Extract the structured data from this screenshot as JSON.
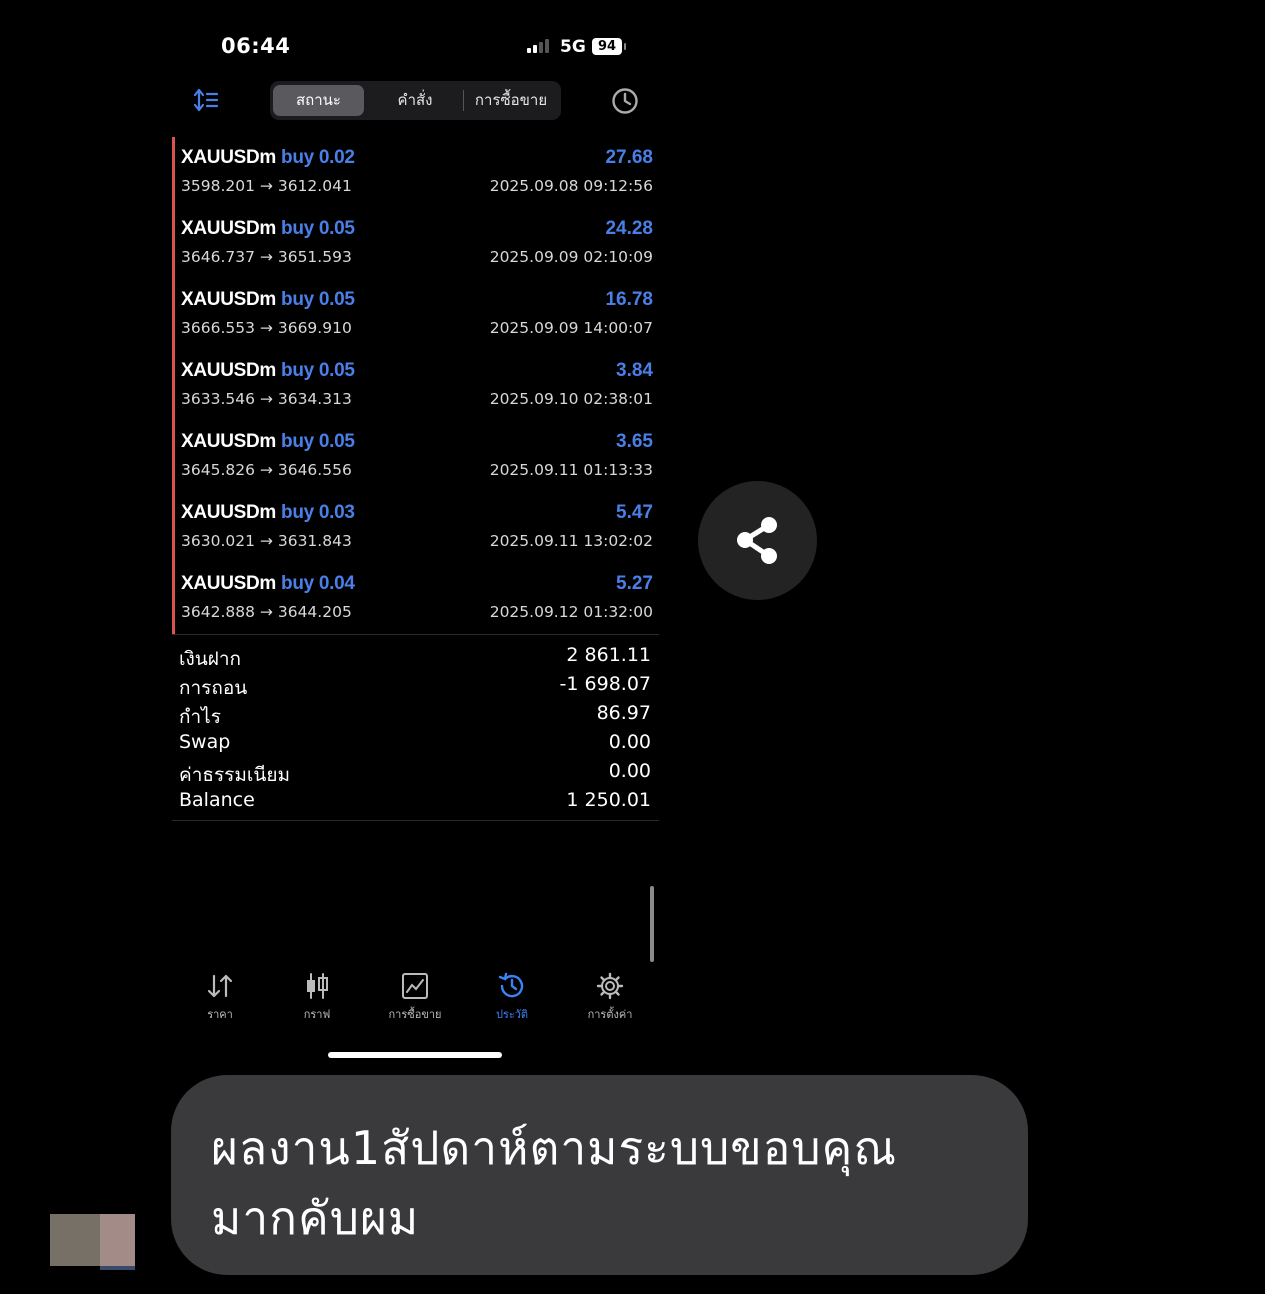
{
  "status_bar": {
    "time": "06:44",
    "network": "5G",
    "battery": "94"
  },
  "top_tabs": [
    "สถานะ",
    "คำสั่ง",
    "การซื้อขาย"
  ],
  "trades": [
    {
      "symbol": "XAUUSDm",
      "side": "buy",
      "volume": "0.02",
      "open": "3598.201",
      "close": "3612.041",
      "arrow": "→",
      "profit": "27.68",
      "time": "2025.09.08 09:12:56"
    },
    {
      "symbol": "XAUUSDm",
      "side": "buy",
      "volume": "0.05",
      "open": "3646.737",
      "close": "3651.593",
      "arrow": "→",
      "profit": "24.28",
      "time": "2025.09.09 02:10:09"
    },
    {
      "symbol": "XAUUSDm",
      "side": "buy",
      "volume": "0.05",
      "open": "3666.553",
      "close": "3669.910",
      "arrow": "→",
      "profit": "16.78",
      "time": "2025.09.09 14:00:07"
    },
    {
      "symbol": "XAUUSDm",
      "side": "buy",
      "volume": "0.05",
      "open": "3633.546",
      "close": "3634.313",
      "arrow": "→",
      "profit": "3.84",
      "time": "2025.09.10 02:38:01"
    },
    {
      "symbol": "XAUUSDm",
      "side": "buy",
      "volume": "0.05",
      "open": "3645.826",
      "close": "3646.556",
      "arrow": "→",
      "profit": "3.65",
      "time": "2025.09.11 01:13:33"
    },
    {
      "symbol": "XAUUSDm",
      "side": "buy",
      "volume": "0.03",
      "open": "3630.021",
      "close": "3631.843",
      "arrow": "→",
      "profit": "5.47",
      "time": "2025.09.11 13:02:02"
    },
    {
      "symbol": "XAUUSDm",
      "side": "buy",
      "volume": "0.04",
      "open": "3642.888",
      "close": "3644.205",
      "arrow": "→",
      "profit": "5.27",
      "time": "2025.09.12 01:32:00"
    }
  ],
  "summary": [
    {
      "label": "เงินฝาก",
      "value": "2 861.11"
    },
    {
      "label": "การถอน",
      "value": "-1 698.07"
    },
    {
      "label": "กำไร",
      "value": "86.97"
    },
    {
      "label": "Swap",
      "value": "0.00"
    },
    {
      "label": "ค่าธรรมเนียม",
      "value": "0.00"
    },
    {
      "label": "Balance",
      "value": "1 250.01"
    }
  ],
  "bottom_nav": [
    {
      "label": "ราคา",
      "icon": "arrows-updown-icon"
    },
    {
      "label": "กราฟ",
      "icon": "candlestick-icon"
    },
    {
      "label": "การซื้อขาย",
      "icon": "trade-chart-icon"
    },
    {
      "label": "ประวัติ",
      "icon": "history-icon",
      "active": true
    },
    {
      "label": "การตั้งค่า",
      "icon": "gear-icon"
    }
  ],
  "message": {
    "line1": "ผลงาน1สัปดาห์ตามระบบขอบคุณ",
    "line2": "มากคับผม"
  },
  "colors": {
    "accent": "#4a7fe8",
    "active_nav": "#3b82f6",
    "trade_marker": "#d9534f",
    "bubble": "#3a3a3c"
  }
}
